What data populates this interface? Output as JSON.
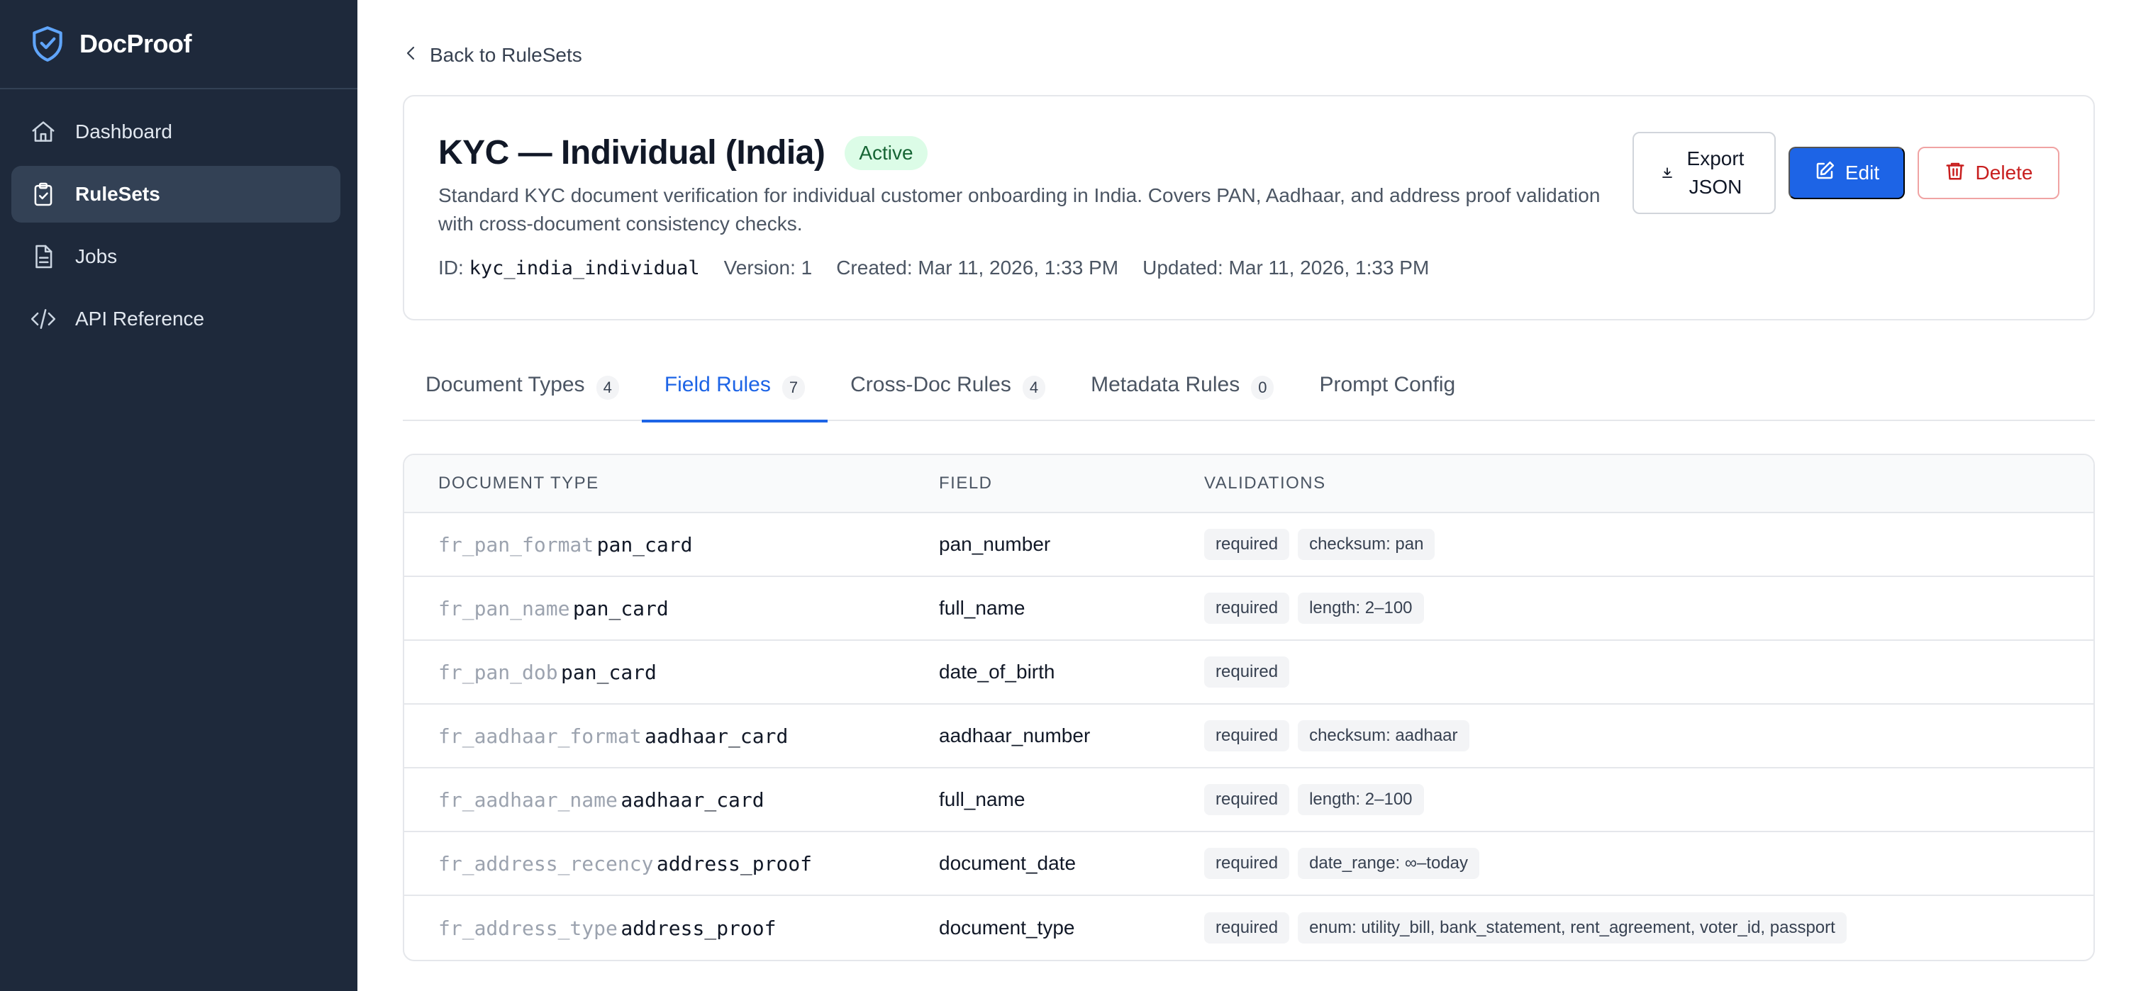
{
  "brand": {
    "name": "DocProof"
  },
  "sidebar": {
    "items": [
      {
        "label": "Dashboard",
        "icon": "home-icon"
      },
      {
        "label": "RuleSets",
        "icon": "clipboard-check-icon"
      },
      {
        "label": "Jobs",
        "icon": "document-icon"
      },
      {
        "label": "API Reference",
        "icon": "code-icon"
      }
    ],
    "active": "RuleSets"
  },
  "back_label": "Back to RuleSets",
  "ruleset": {
    "title": "KYC — Individual (India)",
    "status": "Active",
    "description": "Standard KYC document verification for individual customer onboarding in India. Covers PAN, Aadhaar, and address proof validation with cross-document consistency checks.",
    "id_label": "ID:",
    "id": "kyc_india_individual",
    "version": "Version: 1",
    "created": "Created: Mar 11, 2026, 1:33 PM",
    "updated": "Updated: Mar 11, 2026, 1:33 PM"
  },
  "actions": {
    "export_line1": "Export",
    "export_line2": "JSON",
    "edit": "Edit",
    "delete": "Delete"
  },
  "tabs": [
    {
      "label": "Document Types",
      "count": "4"
    },
    {
      "label": "Field Rules",
      "count": "7"
    },
    {
      "label": "Cross-Doc Rules",
      "count": "4"
    },
    {
      "label": "Metadata Rules",
      "count": "0"
    },
    {
      "label": "Prompt Config",
      "count": ""
    }
  ],
  "active_tab": "Field Rules",
  "table": {
    "headers": [
      "DOCUMENT TYPE",
      "FIELD",
      "VALIDATIONS"
    ],
    "rows": [
      {
        "rule_id": "fr_pan_format",
        "doc_type": "pan_card",
        "field": "pan_number",
        "validations": [
          "required",
          "checksum: pan"
        ]
      },
      {
        "rule_id": "fr_pan_name",
        "doc_type": "pan_card",
        "field": "full_name",
        "validations": [
          "required",
          "length: 2–100"
        ]
      },
      {
        "rule_id": "fr_pan_dob",
        "doc_type": "pan_card",
        "field": "date_of_birth",
        "validations": [
          "required"
        ]
      },
      {
        "rule_id": "fr_aadhaar_format",
        "doc_type": "aadhaar_card",
        "field": "aadhaar_number",
        "validations": [
          "required",
          "checksum: aadhaar"
        ]
      },
      {
        "rule_id": "fr_aadhaar_name",
        "doc_type": "aadhaar_card",
        "field": "full_name",
        "validations": [
          "required",
          "length: 2–100"
        ]
      },
      {
        "rule_id": "fr_address_recency",
        "doc_type": "address_proof",
        "field": "document_date",
        "validations": [
          "required",
          "date_range: ∞–today"
        ]
      },
      {
        "rule_id": "fr_address_type",
        "doc_type": "address_proof",
        "field": "document_type",
        "validations": [
          "required",
          "enum: utility_bill, bank_statement, rent_agreement, voter_id, passport"
        ]
      }
    ]
  },
  "colors": {
    "sidebar_bg": "#1e293b",
    "accent": "#1d64e6",
    "active_badge_bg": "#dcfce7",
    "active_badge_text": "#166534",
    "danger": "#c81e1e"
  }
}
